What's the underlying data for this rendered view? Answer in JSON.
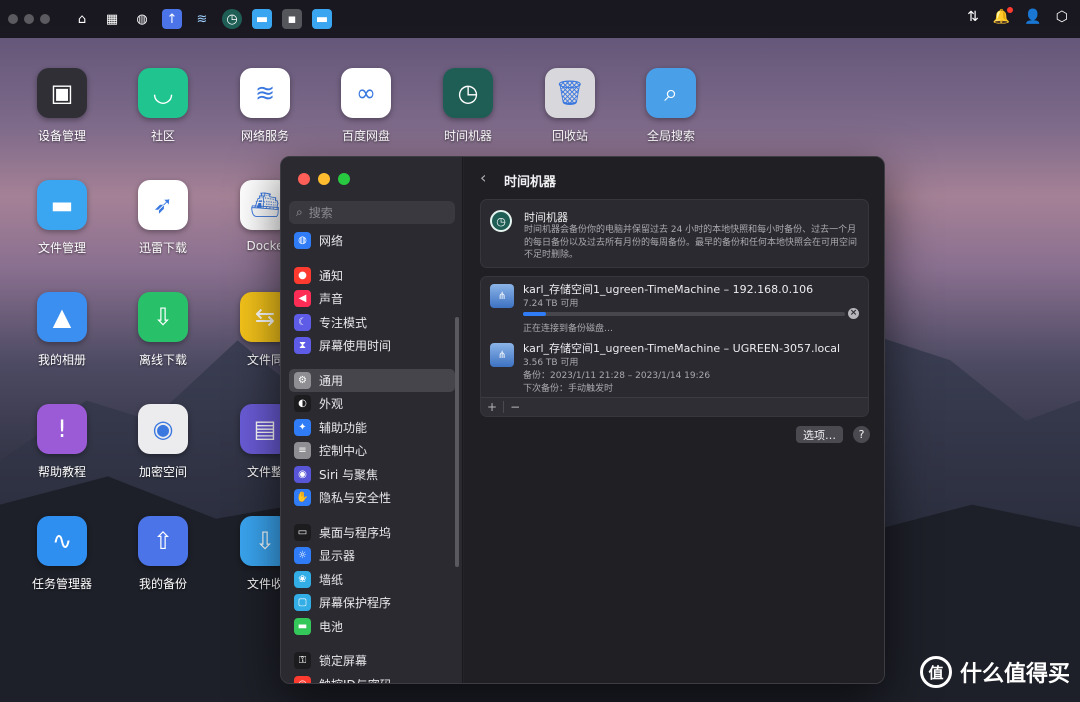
{
  "topbar": {
    "icons": [
      "home-icon",
      "apps-grid-icon",
      "globe-icon",
      "backup-app-icon",
      "network-icon",
      "time-machine-icon",
      "folder-icon",
      "device-icon",
      "folder-blue-icon"
    ],
    "right_icons": [
      "sync-icon",
      "bell-icon",
      "user-icon",
      "settings-icon"
    ]
  },
  "desktop": {
    "apps": [
      {
        "label": "设备管理",
        "icon": "device-manager-icon",
        "color": "#2f2f35"
      },
      {
        "label": "社区",
        "icon": "community-icon",
        "color": "#1fc48e"
      },
      {
        "label": "网络服务",
        "icon": "wifi-icon",
        "color": "#ffffff"
      },
      {
        "label": "百度网盘",
        "icon": "baidu-pan-icon",
        "color": "#ffffff"
      },
      {
        "label": "时间机器",
        "icon": "time-machine-icon",
        "color": "#1f5e55"
      },
      {
        "label": "回收站",
        "icon": "trash-icon",
        "color": "#d8d8dc"
      },
      {
        "label": "全局搜索",
        "icon": "search-icon",
        "color": "#4aa0e8"
      },
      {
        "label": "文件管理",
        "icon": "folder-icon",
        "color": "#3aa5f0"
      },
      {
        "label": "迅雷下载",
        "icon": "thunder-icon",
        "color": "#ffffff"
      },
      {
        "label": "Docke",
        "icon": "docker-icon",
        "color": "#ffffff"
      },
      {
        "label": "我的相册",
        "icon": "photos-icon",
        "color": "#3b8ff0"
      },
      {
        "label": "离线下载",
        "icon": "download-icon",
        "color": "#29c06a"
      },
      {
        "label": "文件同",
        "icon": "sync-files-icon",
        "color": "#f3c21a"
      },
      {
        "label": "帮助教程",
        "icon": "help-icon",
        "color": "#9b5bd6"
      },
      {
        "label": "加密空间",
        "icon": "safe-icon",
        "color": "#ececee"
      },
      {
        "label": "文件整",
        "icon": "file-organize-icon",
        "color": "#6a5bd6"
      },
      {
        "label": "任务管理器",
        "icon": "task-manager-icon",
        "color": "#2f8ff0"
      },
      {
        "label": "我的备份",
        "icon": "backup-icon",
        "color": "#4a74e8"
      },
      {
        "label": "文件收",
        "icon": "file-collect-icon",
        "color": "#3aa5f0"
      }
    ]
  },
  "window": {
    "search_placeholder": "搜索",
    "nav_groups": [
      [
        {
          "label": "网络",
          "icon": "globe-icon",
          "color": "#2f7cf6"
        }
      ],
      [
        {
          "label": "通知",
          "icon": "notification-icon",
          "color": "#ff3b30"
        },
        {
          "label": "声音",
          "icon": "sound-icon",
          "color": "#ff2d55"
        },
        {
          "label": "专注模式",
          "icon": "moon-icon",
          "color": "#5e5ce6"
        },
        {
          "label": "屏幕使用时间",
          "icon": "hourglass-icon",
          "color": "#5e5ce6"
        }
      ],
      [
        {
          "label": "通用",
          "icon": "gear-icon",
          "color": "#8e8e93",
          "selected": true
        },
        {
          "label": "外观",
          "icon": "appearance-icon",
          "color": "#1c1c1e"
        },
        {
          "label": "辅助功能",
          "icon": "accessibility-icon",
          "color": "#2f7cf6"
        },
        {
          "label": "控制中心",
          "icon": "control-center-icon",
          "color": "#8e8e93"
        },
        {
          "label": "Siri 与聚焦",
          "icon": "siri-icon",
          "color": "#5856d6"
        },
        {
          "label": "隐私与安全性",
          "icon": "hand-icon",
          "color": "#2f7cf6"
        }
      ],
      [
        {
          "label": "桌面与程序坞",
          "icon": "dock-icon",
          "color": "#1c1c1e"
        },
        {
          "label": "显示器",
          "icon": "display-icon",
          "color": "#2f7cf6"
        },
        {
          "label": "墙纸",
          "icon": "wallpaper-icon",
          "color": "#32ade6"
        },
        {
          "label": "屏幕保护程序",
          "icon": "screensaver-icon",
          "color": "#32ade6"
        },
        {
          "label": "电池",
          "icon": "battery-icon",
          "color": "#34c759"
        }
      ],
      [
        {
          "label": "锁定屏幕",
          "icon": "lock-icon",
          "color": "#1c1c1e"
        },
        {
          "label": "触控ID与密码",
          "icon": "fingerprint-icon",
          "color": "#ff3b30"
        }
      ]
    ],
    "content": {
      "title": "时间机器",
      "info_title": "时间机器",
      "info_desc": "时间机器会备份你的电脑并保留过去 24 小时的本地快照和每小时备份、过去一个月的每日备份以及过去所有月份的每周备份。最早的备份和任何本地快照会在可用空间不足时删除。",
      "disks": [
        {
          "name": "karl_存储空间1_ugreen-TimeMachine – 192.168.0.106",
          "size": "7.24 TB 可用",
          "progress": 0.07,
          "status": "正在连接到备份磁盘…"
        },
        {
          "name": "karl_存储空间1_ugreen-TimeMachine – UGREEN-3057.local",
          "size": "3.56 TB 可用",
          "backup_range": "备份：2023/1/11 21:28 – 2023/1/14 19:26",
          "next_backup": "下次备份：手动触发时"
        }
      ],
      "add_label": "+",
      "remove_label": "−",
      "options_label": "选项…",
      "help_label": "?"
    }
  },
  "watermark": {
    "text": "什么值得买",
    "icon_text": "值"
  }
}
